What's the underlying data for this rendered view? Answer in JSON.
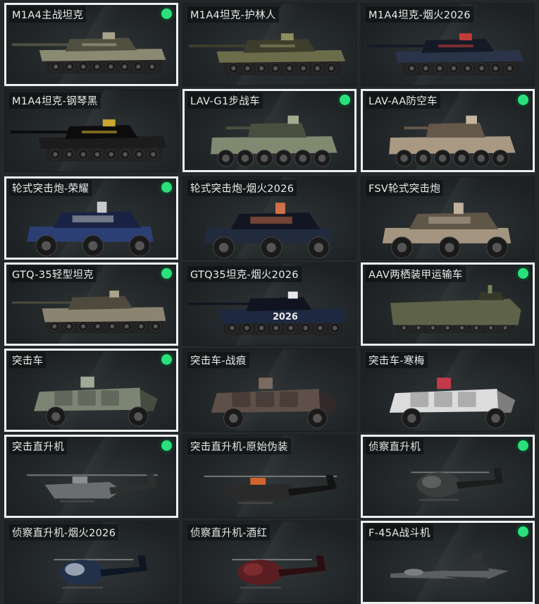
{
  "vehicles": [
    {
      "label": "M1A4主战坦克",
      "selected": true,
      "owned": true,
      "kind": "tank",
      "body": "#8a8a72",
      "dark": "#4f5040",
      "accent": "#a8a48c"
    },
    {
      "label": "M1A4坦克-护林人",
      "selected": false,
      "owned": false,
      "kind": "tank",
      "body": "#6b6d4a",
      "dark": "#3c3e2b",
      "accent": "#8f8e62"
    },
    {
      "label": "M1A4坦克-烟火2026",
      "selected": false,
      "owned": false,
      "kind": "tank",
      "body": "#2a3348",
      "dark": "#151a26",
      "accent": "#c23b3b"
    },
    {
      "label": "M1A4坦克-钢琴黑",
      "selected": false,
      "owned": false,
      "kind": "tank",
      "body": "#1c1c1c",
      "dark": "#0c0c0c",
      "accent": "#c8a832"
    },
    {
      "label": "LAV-G1步战车",
      "selected": true,
      "owned": true,
      "kind": "lav",
      "body": "#808a70",
      "dark": "#4a5040",
      "accent": "#a3ab90"
    },
    {
      "label": "LAV-AA防空车",
      "selected": true,
      "owned": true,
      "kind": "lav",
      "body": "#a99882",
      "dark": "#64584a",
      "accent": "#c4b59f"
    },
    {
      "label": "轮式突击炮-荣耀",
      "selected": true,
      "owned": true,
      "kind": "wheeled",
      "body": "#2c3f74",
      "dark": "#182344",
      "accent": "#c9c9c9"
    },
    {
      "label": "轮式突击炮-烟火2026",
      "selected": false,
      "owned": false,
      "kind": "wheeled",
      "body": "#222a3e",
      "dark": "#121622",
      "accent": "#d0704a"
    },
    {
      "label": "FSV轮式突击炮",
      "selected": false,
      "owned": false,
      "kind": "wheeled",
      "body": "#a39580",
      "dark": "#5f5648",
      "accent": "#bfb29c"
    },
    {
      "label": "GTQ-35轻型坦克",
      "selected": true,
      "owned": true,
      "kind": "light",
      "body": "#8a8470",
      "dark": "#4e4a3e",
      "accent": "#a9a28c"
    },
    {
      "label": "GTQ35坦克-烟火2026",
      "selected": false,
      "owned": false,
      "kind": "light",
      "body": "#1e2840",
      "dark": "#0f1420",
      "accent": "#e8e8e8",
      "decal": "2026"
    },
    {
      "label": "AAV两栖装甲运输车",
      "selected": true,
      "owned": true,
      "kind": "aav",
      "body": "#5d6248",
      "dark": "#353828",
      "accent": "#7a7f5f"
    },
    {
      "label": "突击车",
      "selected": true,
      "owned": true,
      "kind": "mrap",
      "body": "#7c8474",
      "dark": "#474c42",
      "accent": "#a0a896"
    },
    {
      "label": "突击车-战痕",
      "selected": false,
      "owned": false,
      "kind": "mrap",
      "body": "#5e5048",
      "dark": "#33292a",
      "accent": "#7a6a5e"
    },
    {
      "label": "突击车-寒梅",
      "selected": false,
      "owned": false,
      "kind": "mrap",
      "body": "#dcdcdc",
      "dark": "#7d7d7d",
      "accent": "#c43a4a"
    },
    {
      "label": "突击直升机",
      "selected": true,
      "owned": true,
      "kind": "apache",
      "body": "#6a6e6e",
      "dark": "#2e3030",
      "accent": "#8b8f8f"
    },
    {
      "label": "突击直升机-原始伪装",
      "selected": false,
      "owned": false,
      "kind": "apache",
      "body": "#2a2a2a",
      "dark": "#141414",
      "accent": "#d2622e"
    },
    {
      "label": "侦察直升机",
      "selected": true,
      "owned": true,
      "kind": "scout",
      "body": "#3c3e3e",
      "dark": "#1c1d1d",
      "accent": "#6b6e6e"
    },
    {
      "label": "侦察直升机-烟火2026",
      "selected": false,
      "owned": false,
      "kind": "scout",
      "body": "#22304a",
      "dark": "#0f1624",
      "accent": "#c9d0dc"
    },
    {
      "label": "侦察直升机-酒红",
      "selected": false,
      "owned": false,
      "kind": "scout",
      "body": "#5a1e22",
      "dark": "#2c0e10",
      "accent": "#8a3238"
    },
    {
      "label": "F-45A战斗机",
      "selected": true,
      "owned": true,
      "kind": "jet",
      "body": "#5c5f62",
      "dark": "#2f3133",
      "accent": "#7b7f83"
    }
  ]
}
